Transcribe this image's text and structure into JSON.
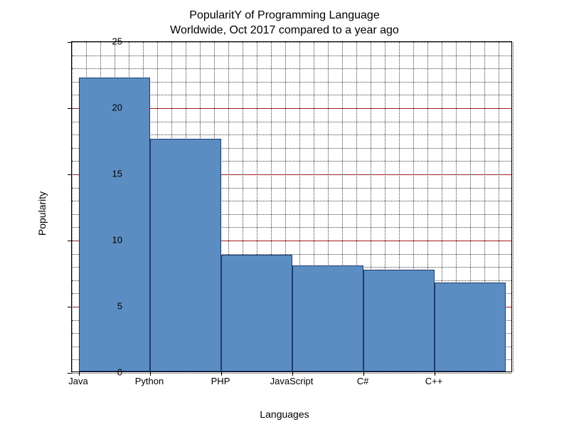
{
  "chart_data": {
    "type": "bar",
    "title_line1": "PopularitY of Programming Language",
    "title_line2": "Worldwide, Oct 2017 compared to a year ago",
    "xlabel": "Languages",
    "ylabel": "Popularity",
    "categories": [
      "Java",
      "Python",
      "PHP",
      "JavaScript",
      "C#",
      "C++"
    ],
    "values": [
      22.2,
      17.6,
      8.8,
      8.0,
      7.7,
      6.7
    ],
    "ylim": [
      0,
      25
    ],
    "yticks": [
      0,
      5,
      10,
      15,
      20,
      25
    ],
    "bar_color": "#5b8dc2",
    "bar_edge": "#1f3a6e",
    "grid_major_color": "#ff0000"
  }
}
